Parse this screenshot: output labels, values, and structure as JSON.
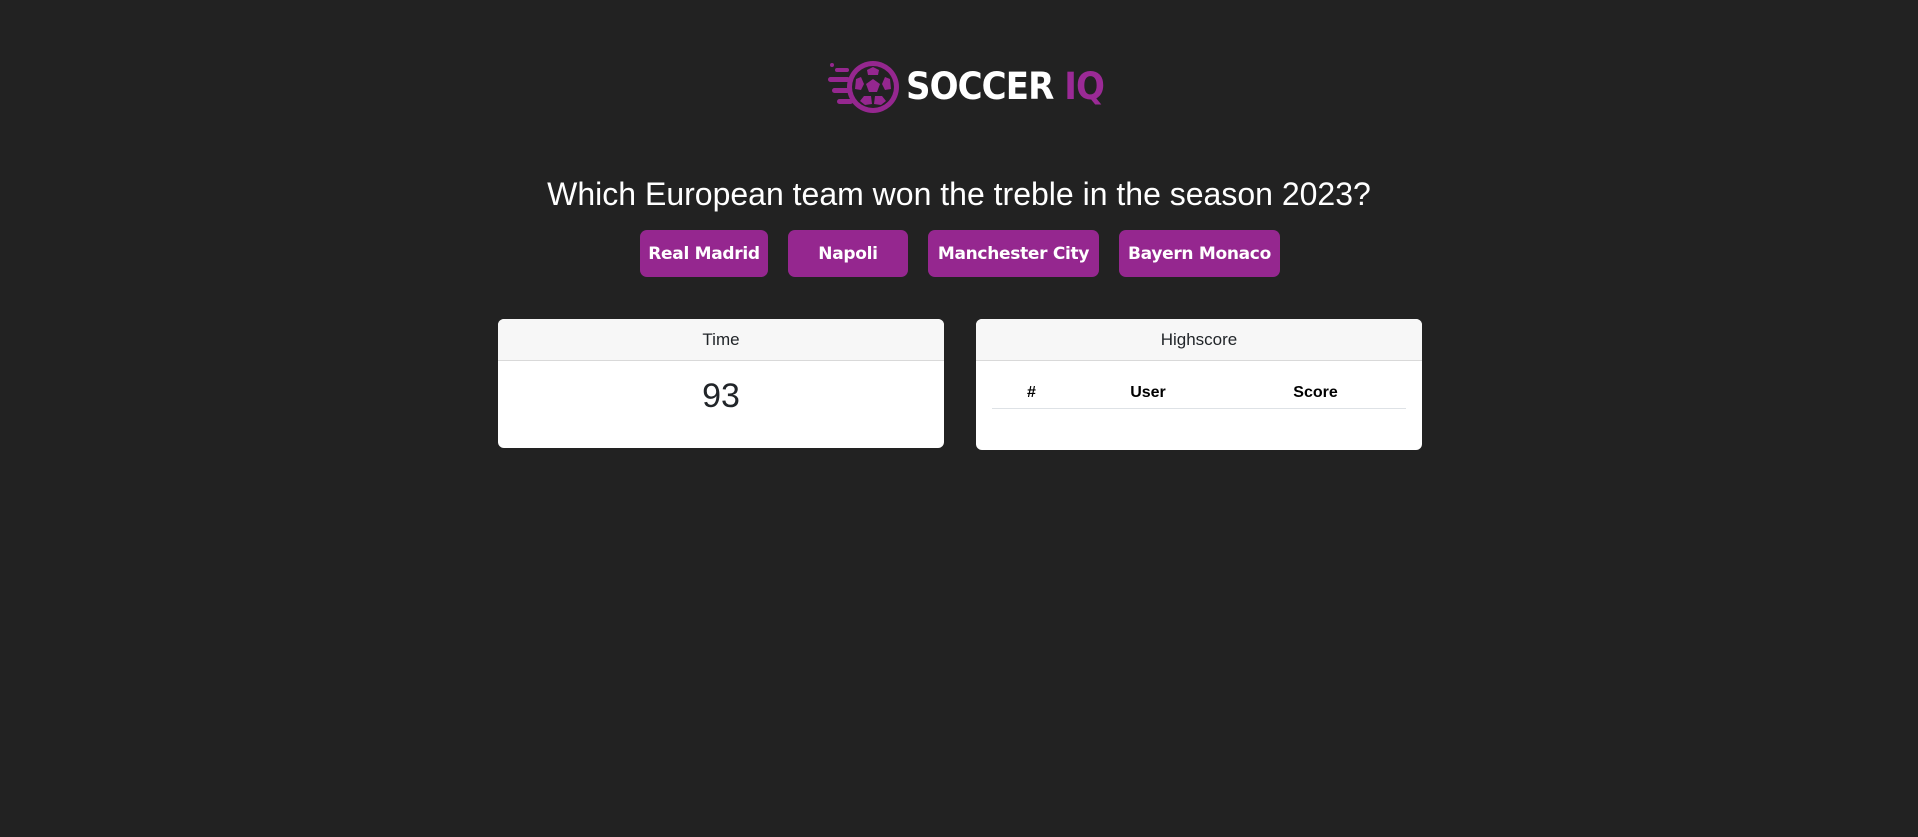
{
  "logo": {
    "word1": "SOCCER",
    "word2": "IQ",
    "icon": "soccer-ball-icon",
    "accent_color": "#95278f"
  },
  "quiz": {
    "question": "Which European team won the treble in the season 2023?",
    "answers": [
      {
        "label": "Real Madrid"
      },
      {
        "label": "Napoli"
      },
      {
        "label": "Manchester City"
      },
      {
        "label": "Bayern Monaco"
      }
    ]
  },
  "timer": {
    "header": "Time",
    "value": "93"
  },
  "highscore": {
    "header": "Highscore",
    "columns": [
      "#",
      "User",
      "Score"
    ],
    "rows": []
  },
  "colors": {
    "background": "#222222",
    "button": "#95278f",
    "card": "#ffffff"
  }
}
